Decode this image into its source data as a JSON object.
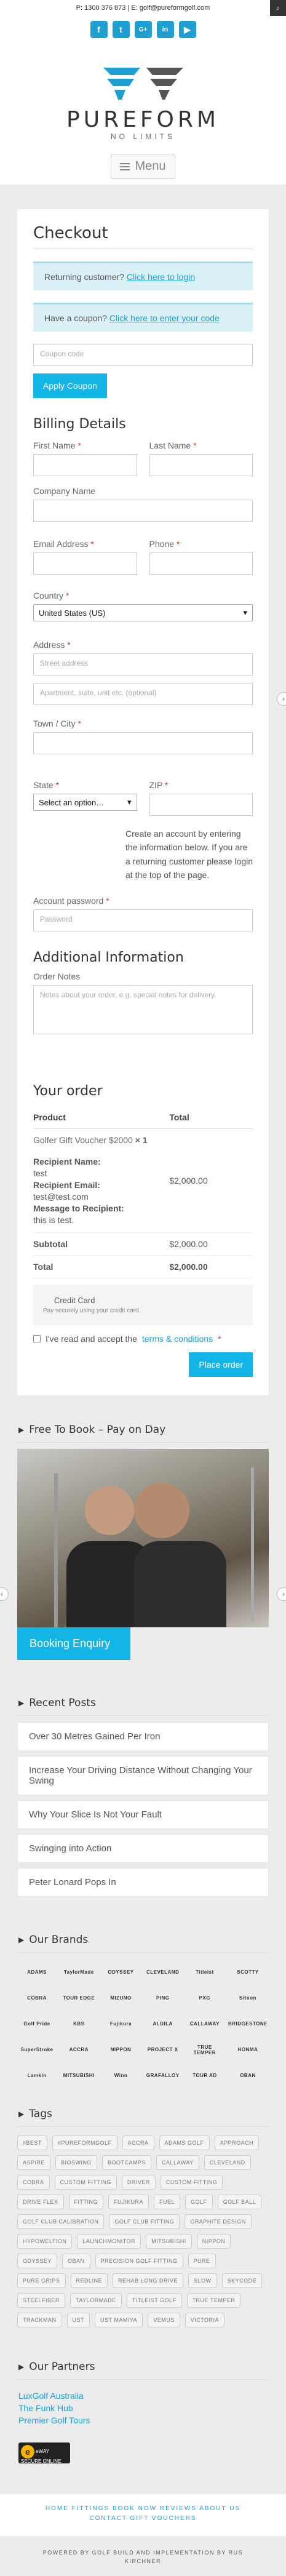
{
  "header": {
    "contact": "P: 1300 376 873 | E: golf@pureformgolf.com",
    "social": [
      "f",
      "t",
      "G+",
      "in",
      "yt"
    ],
    "logo_title": "PUREFORM",
    "logo_sub": "NO LIMITS",
    "menu_label": "Menu"
  },
  "checkout": {
    "title": "Checkout",
    "returning_prefix": "Returning customer?",
    "returning_link": "Click here to login",
    "coupon_prefix": "Have a coupon?",
    "coupon_link": "Click here to enter your code",
    "coupon_placeholder": "Coupon code",
    "apply_coupon": "Apply Coupon",
    "billing_title": "Billing Details",
    "first_name": "First Name",
    "last_name": "Last Name",
    "company_name": "Company Name",
    "email": "Email Address",
    "phone": "Phone",
    "country": "Country",
    "country_value": "United States (US)",
    "address": "Address",
    "street_placeholder": "Street address",
    "apt_placeholder": "Apartment, suite, unit etc. (optional)",
    "town": "Town / City",
    "state": "State",
    "state_value": "Select an option…",
    "zip": "ZIP",
    "account_text": "Create an account by entering the information below. If you are a returning customer please login at the top of the page.",
    "account_password": "Account password",
    "password_placeholder": "Password",
    "additional_title": "Additional Information",
    "order_notes": "Order Notes",
    "order_notes_placeholder": "Notes about your order, e.g. special notes for delivery.",
    "required_mark": "*"
  },
  "order": {
    "title": "Your order",
    "col_product": "Product",
    "col_total": "Total",
    "product_name": "Golfer Gift Voucher $2000",
    "product_qty": "× 1",
    "recipient_name_label": "Recipient Name:",
    "recipient_name": "test",
    "recipient_email_label": "Recipient Email:",
    "recipient_email": "test@test.com",
    "message_label": "Message to Recipient:",
    "message": "this is test.",
    "line_total": "$2,000.00",
    "subtotal_label": "Subtotal",
    "subtotal": "$2,000.00",
    "total_label": "Total",
    "total": "$2,000.00",
    "payment_method": "Credit Card",
    "payment_sub": "Pay securely using your credit card.",
    "terms_prefix": "I've read and accept the",
    "terms_link": "terms & conditions",
    "terms_req": "*",
    "place_order": "Place order"
  },
  "free_to_book": {
    "title": "Free To Book – Pay on Day",
    "button": "Booking Enquiry"
  },
  "recent_posts": {
    "title": "Recent Posts",
    "items": [
      "Over 30 Metres Gained Per Iron",
      "Increase Your Driving Distance Without Changing Your Swing",
      "Why Your Slice Is Not Your Fault",
      "Swinging into Action",
      "Peter Lonard Pops In"
    ]
  },
  "brands": {
    "title": "Our Brands",
    "items": [
      "ADAMS",
      "TaylorMade",
      "ODYSSEY",
      "CLEVELAND",
      "Titleist",
      "SCOTTY",
      "COBRA",
      "TOUR EDGE",
      "MIZUNO",
      "PING",
      "PXG",
      "Srixon",
      "Golf Pride",
      "KBS",
      "Fujikura",
      "ALDILA",
      "CALLAWAY",
      "BRIDGESTONE",
      "SuperStroke",
      "ACCRA",
      "NIPPON",
      "PROJECT X",
      "TRUE TEMPER",
      "HONMA",
      "Lamkin",
      "MITSUBISHI",
      "Winn",
      "GRAFALLOY",
      "TOUR AD",
      "OBAN"
    ]
  },
  "tags": {
    "title": "Tags",
    "items": [
      "#BEST",
      "#PUREFORMGOLF",
      "ACCRA",
      "ADAMS GOLF",
      "APPROACH",
      "ASPIRE",
      "BIOSWING",
      "BOOTCAMPS",
      "CALLAWAY",
      "CLEVELAND",
      "COBRA",
      "CUSTOM FITTING",
      "DRIVER",
      "CUSTOM FITTING",
      "DRIVE FLEX",
      "FITTING",
      "FUJIKURA",
      "FUEL",
      "GOLF",
      "GOLF BALL",
      "GOLF CLUB CALIBRATION",
      "GOLF CLUB FITTING",
      "GRAPHITE DESIGN",
      "HYPOWELTION",
      "LAUNCHMONITOR",
      "MITSUBISHI",
      "NIPPON",
      "ODYSSEY",
      "OBAN",
      "PRECISION GOLF FITTING",
      "PURE",
      "PURE GRIPS",
      "REDLINE",
      "REHAB LONG DRIVE",
      "SLOW",
      "SKYCODE",
      "STEELFIBER",
      "TAYLORMADE",
      "TITLEIST GOLF",
      "TRUE TEMPER",
      "TRACKMAN",
      "UST",
      "UST MAMIYA",
      "VEMUS",
      "VICTORIA"
    ]
  },
  "partners": {
    "title": "Our Partners",
    "items": [
      "LuxGolf Australia",
      "The Funk Hub",
      "Premier Golf Tours"
    ],
    "badge_text": "eWAY SECURE ONLINE"
  },
  "footer": {
    "nav_line1": "HOME  FITTINGS  BOOK NOW  REVIEWS  ABOUT US",
    "nav_line2": "CONTACT  GIFT VOUCHERS",
    "copyright_line1": "POWERED BY GOLF BUILD AND IMPLEMENTATION BY RUS",
    "copyright_line2": "KIRCHNER"
  }
}
